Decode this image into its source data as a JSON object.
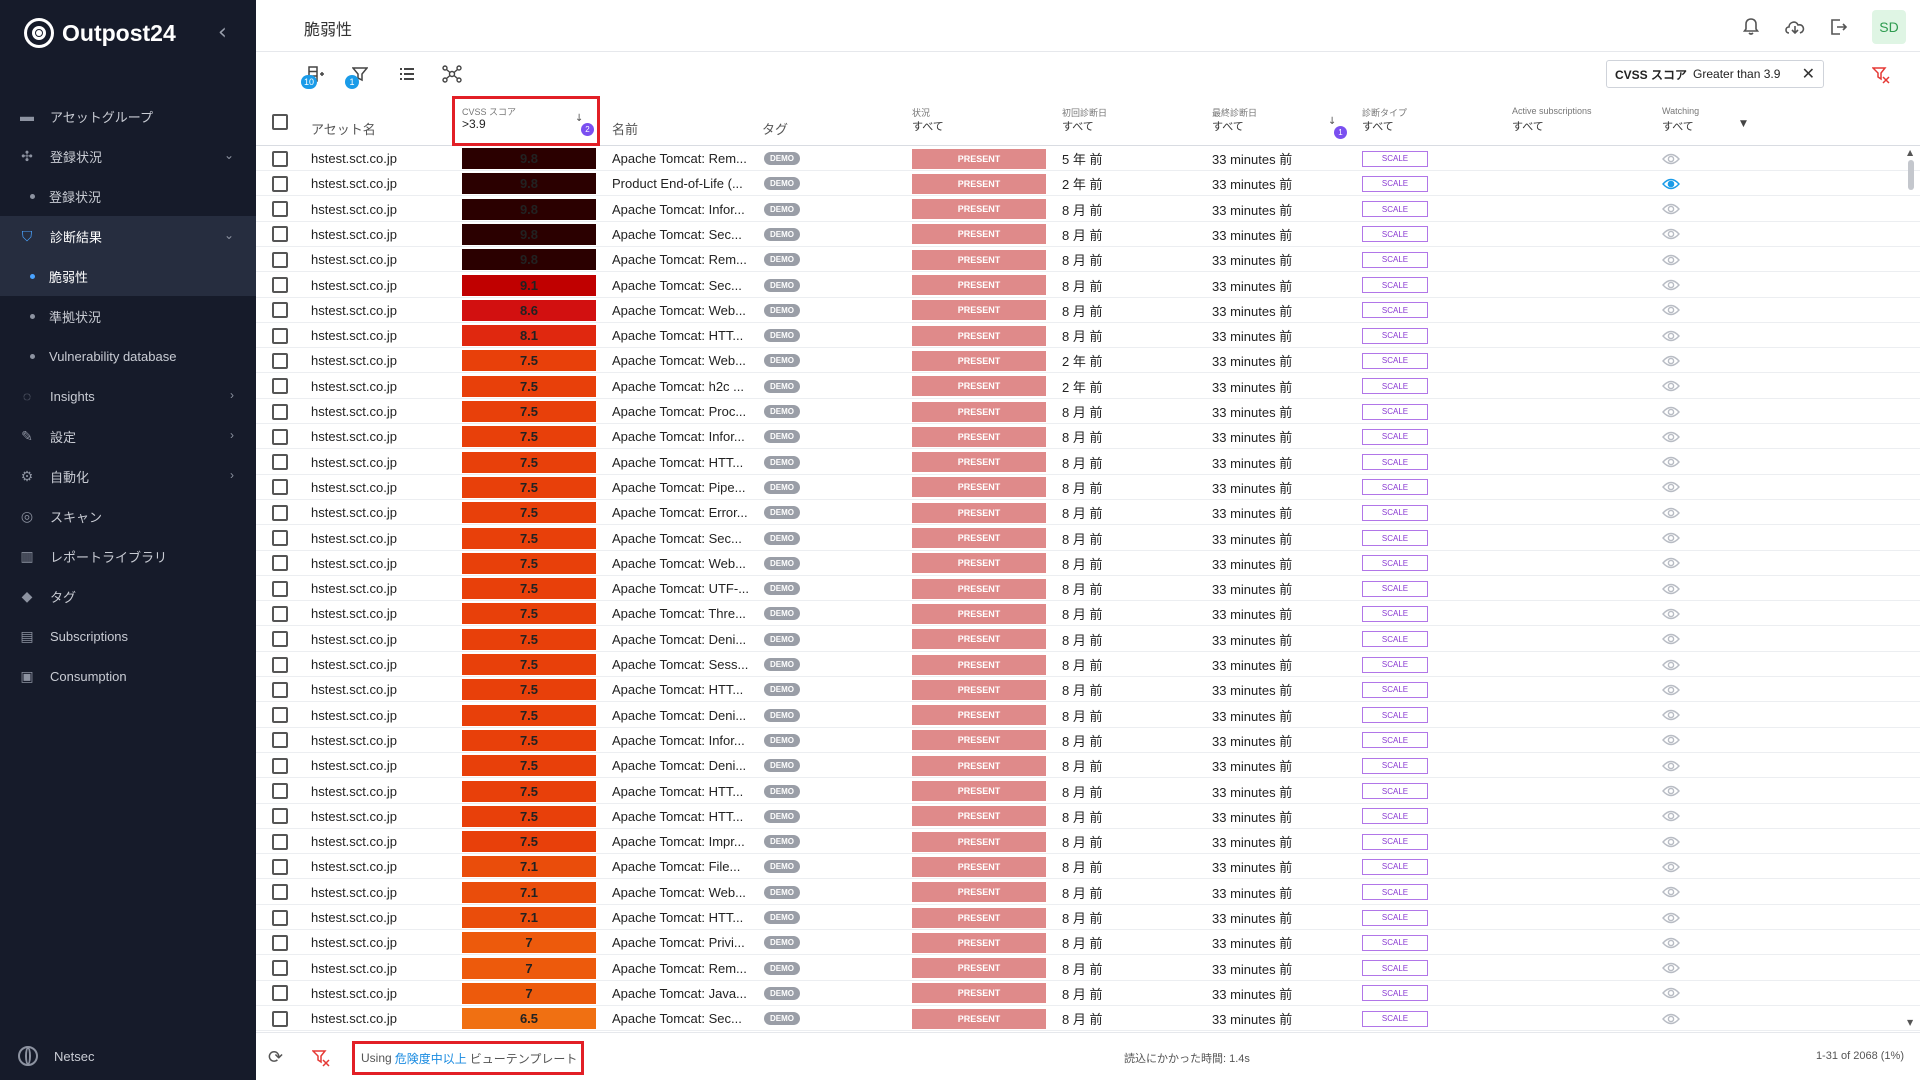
{
  "brand": {
    "name": "Outpost24"
  },
  "sidebar": {
    "items": [
      {
        "label": "アセットグループ",
        "icon": "folder-icon",
        "type": "item"
      },
      {
        "label": "登録状況",
        "icon": "network-icon",
        "type": "item",
        "chevron": "down"
      },
      {
        "label": "登録状況",
        "type": "sub"
      },
      {
        "label": "診断結果",
        "icon": "shield-icon",
        "type": "item",
        "chevron": "down",
        "open": true
      },
      {
        "label": "脆弱性",
        "type": "sub",
        "active": true
      },
      {
        "label": "準拠状況",
        "type": "sub"
      },
      {
        "label": "Vulnerability database",
        "type": "sub"
      },
      {
        "label": "Insights",
        "icon": "lightbulb-icon",
        "type": "item",
        "chevron": "right"
      },
      {
        "label": "設定",
        "icon": "wrench-icon",
        "type": "item",
        "chevron": "right"
      },
      {
        "label": "自動化",
        "icon": "automation-icon",
        "type": "item",
        "chevron": "right"
      },
      {
        "label": "スキャン",
        "icon": "scan-icon",
        "type": "item"
      },
      {
        "label": "レポートライブラリ",
        "icon": "library-icon",
        "type": "item"
      },
      {
        "label": "タグ",
        "icon": "tag-icon",
        "type": "item"
      },
      {
        "label": "Subscriptions",
        "icon": "subscriptions-icon",
        "type": "item"
      },
      {
        "label": "Consumption",
        "icon": "consumption-icon",
        "type": "item"
      }
    ],
    "footer_label": "Netsec"
  },
  "header": {
    "title": "脆弱性",
    "avatar": "SD"
  },
  "toolbar": {
    "badge_columns": "10",
    "badge_filters": "1",
    "filter_chip": {
      "field": "CVSS スコア",
      "condition": "Greater than 3.9"
    }
  },
  "columns": {
    "asset": "アセット名",
    "cvss": {
      "label": "CVSS スコア",
      "value": ">3.9",
      "sort_badge": "2"
    },
    "name": "名前",
    "tag": "タグ",
    "status": {
      "label": "状況",
      "value": "すべて"
    },
    "first_seen": {
      "label": "初回診断日",
      "value": "すべて"
    },
    "last_seen": {
      "label": "最終診断日",
      "value": "すべて",
      "sort_badge": "1"
    },
    "scan_type": {
      "label": "診断タイプ",
      "value": "すべて"
    },
    "active_subs": {
      "label": "Active subscriptions",
      "value": "すべて"
    },
    "watching": {
      "label": "Watching",
      "value": "すべて"
    }
  },
  "rows": [
    {
      "asset": "hstest.sct.co.jp",
      "score": "9.8",
      "color": "#2b0000",
      "name": "Apache Tomcat: Rem...",
      "tag": "DEMO",
      "status": "PRESENT",
      "first": "5 年 前",
      "last": "33 minutes 前",
      "type": "SCALE",
      "watching": false
    },
    {
      "asset": "hstest.sct.co.jp",
      "score": "9.8",
      "color": "#2b0000",
      "name": "Product End-of-Life (...",
      "tag": "DEMO",
      "status": "PRESENT",
      "first": "2 年 前",
      "last": "33 minutes 前",
      "type": "SCALE",
      "watching": true
    },
    {
      "asset": "hstest.sct.co.jp",
      "score": "9.8",
      "color": "#2b0000",
      "name": "Apache Tomcat: Infor...",
      "tag": "DEMO",
      "status": "PRESENT",
      "first": "8 月 前",
      "last": "33 minutes 前",
      "type": "SCALE",
      "watching": false
    },
    {
      "asset": "hstest.sct.co.jp",
      "score": "9.8",
      "color": "#2b0000",
      "name": "Apache Tomcat: Sec...",
      "tag": "DEMO",
      "status": "PRESENT",
      "first": "8 月 前",
      "last": "33 minutes 前",
      "type": "SCALE",
      "watching": false
    },
    {
      "asset": "hstest.sct.co.jp",
      "score": "9.8",
      "color": "#2b0000",
      "name": "Apache Tomcat: Rem...",
      "tag": "DEMO",
      "status": "PRESENT",
      "first": "8 月 前",
      "last": "33 minutes 前",
      "type": "SCALE",
      "watching": false
    },
    {
      "asset": "hstest.sct.co.jp",
      "score": "9.1",
      "color": "#c00000",
      "name": "Apache Tomcat: Sec...",
      "tag": "DEMO",
      "status": "PRESENT",
      "first": "8 月 前",
      "last": "33 minutes 前",
      "type": "SCALE",
      "watching": false
    },
    {
      "asset": "hstest.sct.co.jp",
      "score": "8.6",
      "color": "#d21010",
      "name": "Apache Tomcat: Web...",
      "tag": "DEMO",
      "status": "PRESENT",
      "first": "8 月 前",
      "last": "33 minutes 前",
      "type": "SCALE",
      "watching": false
    },
    {
      "asset": "hstest.sct.co.jp",
      "score": "8.1",
      "color": "#e0280f",
      "name": "Apache Tomcat: HTT...",
      "tag": "DEMO",
      "status": "PRESENT",
      "first": "8 月 前",
      "last": "33 minutes 前",
      "type": "SCALE",
      "watching": false
    },
    {
      "asset": "hstest.sct.co.jp",
      "score": "7.5",
      "color": "#e8400a",
      "name": "Apache Tomcat: Web...",
      "tag": "DEMO",
      "status": "PRESENT",
      "first": "2 年 前",
      "last": "33 minutes 前",
      "type": "SCALE",
      "watching": false
    },
    {
      "asset": "hstest.sct.co.jp",
      "score": "7.5",
      "color": "#e8400a",
      "name": "Apache Tomcat: h2c ...",
      "tag": "DEMO",
      "status": "PRESENT",
      "first": "2 年 前",
      "last": "33 minutes 前",
      "type": "SCALE",
      "watching": false
    },
    {
      "asset": "hstest.sct.co.jp",
      "score": "7.5",
      "color": "#e8400a",
      "name": "Apache Tomcat: Proc...",
      "tag": "DEMO",
      "status": "PRESENT",
      "first": "8 月 前",
      "last": "33 minutes 前",
      "type": "SCALE",
      "watching": false
    },
    {
      "asset": "hstest.sct.co.jp",
      "score": "7.5",
      "color": "#e8400a",
      "name": "Apache Tomcat: Infor...",
      "tag": "DEMO",
      "status": "PRESENT",
      "first": "8 月 前",
      "last": "33 minutes 前",
      "type": "SCALE",
      "watching": false
    },
    {
      "asset": "hstest.sct.co.jp",
      "score": "7.5",
      "color": "#e8400a",
      "name": "Apache Tomcat: HTT...",
      "tag": "DEMO",
      "status": "PRESENT",
      "first": "8 月 前",
      "last": "33 minutes 前",
      "type": "SCALE",
      "watching": false
    },
    {
      "asset": "hstest.sct.co.jp",
      "score": "7.5",
      "color": "#e8400a",
      "name": "Apache Tomcat: Pipe...",
      "tag": "DEMO",
      "status": "PRESENT",
      "first": "8 月 前",
      "last": "33 minutes 前",
      "type": "SCALE",
      "watching": false
    },
    {
      "asset": "hstest.sct.co.jp",
      "score": "7.5",
      "color": "#e8400a",
      "name": "Apache Tomcat: Error...",
      "tag": "DEMO",
      "status": "PRESENT",
      "first": "8 月 前",
      "last": "33 minutes 前",
      "type": "SCALE",
      "watching": false
    },
    {
      "asset": "hstest.sct.co.jp",
      "score": "7.5",
      "color": "#e8400a",
      "name": "Apache Tomcat: Sec...",
      "tag": "DEMO",
      "status": "PRESENT",
      "first": "8 月 前",
      "last": "33 minutes 前",
      "type": "SCALE",
      "watching": false
    },
    {
      "asset": "hstest.sct.co.jp",
      "score": "7.5",
      "color": "#e8400a",
      "name": "Apache Tomcat: Web...",
      "tag": "DEMO",
      "status": "PRESENT",
      "first": "8 月 前",
      "last": "33 minutes 前",
      "type": "SCALE",
      "watching": false
    },
    {
      "asset": "hstest.sct.co.jp",
      "score": "7.5",
      "color": "#e8400a",
      "name": "Apache Tomcat: UTF-...",
      "tag": "DEMO",
      "status": "PRESENT",
      "first": "8 月 前",
      "last": "33 minutes 前",
      "type": "SCALE",
      "watching": false
    },
    {
      "asset": "hstest.sct.co.jp",
      "score": "7.5",
      "color": "#e8400a",
      "name": "Apache Tomcat: Thre...",
      "tag": "DEMO",
      "status": "PRESENT",
      "first": "8 月 前",
      "last": "33 minutes 前",
      "type": "SCALE",
      "watching": false
    },
    {
      "asset": "hstest.sct.co.jp",
      "score": "7.5",
      "color": "#e8400a",
      "name": "Apache Tomcat: Deni...",
      "tag": "DEMO",
      "status": "PRESENT",
      "first": "8 月 前",
      "last": "33 minutes 前",
      "type": "SCALE",
      "watching": false
    },
    {
      "asset": "hstest.sct.co.jp",
      "score": "7.5",
      "color": "#e8400a",
      "name": "Apache Tomcat: Sess...",
      "tag": "DEMO",
      "status": "PRESENT",
      "first": "8 月 前",
      "last": "33 minutes 前",
      "type": "SCALE",
      "watching": false
    },
    {
      "asset": "hstest.sct.co.jp",
      "score": "7.5",
      "color": "#e8400a",
      "name": "Apache Tomcat: HTT...",
      "tag": "DEMO",
      "status": "PRESENT",
      "first": "8 月 前",
      "last": "33 minutes 前",
      "type": "SCALE",
      "watching": false
    },
    {
      "asset": "hstest.sct.co.jp",
      "score": "7.5",
      "color": "#e8400a",
      "name": "Apache Tomcat: Deni...",
      "tag": "DEMO",
      "status": "PRESENT",
      "first": "8 月 前",
      "last": "33 minutes 前",
      "type": "SCALE",
      "watching": false
    },
    {
      "asset": "hstest.sct.co.jp",
      "score": "7.5",
      "color": "#e8400a",
      "name": "Apache Tomcat: Infor...",
      "tag": "DEMO",
      "status": "PRESENT",
      "first": "8 月 前",
      "last": "33 minutes 前",
      "type": "SCALE",
      "watching": false
    },
    {
      "asset": "hstest.sct.co.jp",
      "score": "7.5",
      "color": "#e8400a",
      "name": "Apache Tomcat: Deni...",
      "tag": "DEMO",
      "status": "PRESENT",
      "first": "8 月 前",
      "last": "33 minutes 前",
      "type": "SCALE",
      "watching": false
    },
    {
      "asset": "hstest.sct.co.jp",
      "score": "7.5",
      "color": "#e8400a",
      "name": "Apache Tomcat: HTT...",
      "tag": "DEMO",
      "status": "PRESENT",
      "first": "8 月 前",
      "last": "33 minutes 前",
      "type": "SCALE",
      "watching": false
    },
    {
      "asset": "hstest.sct.co.jp",
      "score": "7.5",
      "color": "#e8400a",
      "name": "Apache Tomcat: HTT...",
      "tag": "DEMO",
      "status": "PRESENT",
      "first": "8 月 前",
      "last": "33 minutes 前",
      "type": "SCALE",
      "watching": false
    },
    {
      "asset": "hstest.sct.co.jp",
      "score": "7.5",
      "color": "#e8400a",
      "name": "Apache Tomcat: Impr...",
      "tag": "DEMO",
      "status": "PRESENT",
      "first": "8 月 前",
      "last": "33 minutes 前",
      "type": "SCALE",
      "watching": false
    },
    {
      "asset": "hstest.sct.co.jp",
      "score": "7.1",
      "color": "#ea4d0b",
      "name": "Apache Tomcat: File...",
      "tag": "DEMO",
      "status": "PRESENT",
      "first": "8 月 前",
      "last": "33 minutes 前",
      "type": "SCALE",
      "watching": false
    },
    {
      "asset": "hstest.sct.co.jp",
      "score": "7.1",
      "color": "#ea4d0b",
      "name": "Apache Tomcat: Web...",
      "tag": "DEMO",
      "status": "PRESENT",
      "first": "8 月 前",
      "last": "33 minutes 前",
      "type": "SCALE",
      "watching": false
    },
    {
      "asset": "hstest.sct.co.jp",
      "score": "7.1",
      "color": "#ea4d0b",
      "name": "Apache Tomcat: HTT...",
      "tag": "DEMO",
      "status": "PRESENT",
      "first": "8 月 前",
      "last": "33 minutes 前",
      "type": "SCALE",
      "watching": false
    },
    {
      "asset": "hstest.sct.co.jp",
      "score": "7",
      "color": "#ed5a0c",
      "name": "Apache Tomcat: Privi...",
      "tag": "DEMO",
      "status": "PRESENT",
      "first": "8 月 前",
      "last": "33 minutes 前",
      "type": "SCALE",
      "watching": false
    },
    {
      "asset": "hstest.sct.co.jp",
      "score": "7",
      "color": "#ed5a0c",
      "name": "Apache Tomcat: Rem...",
      "tag": "DEMO",
      "status": "PRESENT",
      "first": "8 月 前",
      "last": "33 minutes 前",
      "type": "SCALE",
      "watching": false
    },
    {
      "asset": "hstest.sct.co.jp",
      "score": "7",
      "color": "#ed5a0c",
      "name": "Apache Tomcat: Java...",
      "tag": "DEMO",
      "status": "PRESENT",
      "first": "8 月 前",
      "last": "33 minutes 前",
      "type": "SCALE",
      "watching": false
    },
    {
      "asset": "hstest.sct.co.jp",
      "score": "6.5",
      "color": "#f07012",
      "name": "Apache Tomcat: Sec...",
      "tag": "DEMO",
      "status": "PRESENT",
      "first": "8 月 前",
      "last": "33 minutes 前",
      "type": "SCALE",
      "watching": false
    }
  ],
  "footer": {
    "template_prefix": "Using",
    "template_link": "危険度中以上",
    "template_suffix": "ビューテンプレート",
    "load_time": "読込にかかった時間: 1.4s",
    "count": "1-31 of 2068 (1%)"
  },
  "colors": {
    "accent": "#1a8be0",
    "highlight_border": "#e21f26",
    "present": "#df8a8a",
    "scale": "#8a3ad2"
  }
}
